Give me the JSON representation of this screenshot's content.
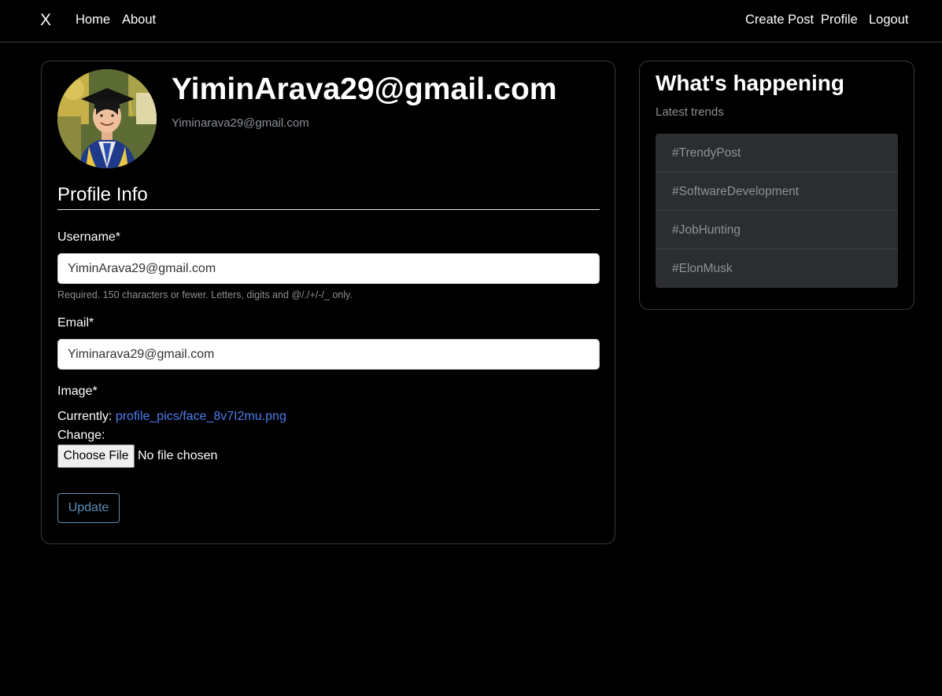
{
  "navbar": {
    "brand": "X",
    "left_links": [
      "Home",
      "About"
    ],
    "right_links": [
      "Create Post",
      "Profile",
      "Logout"
    ]
  },
  "profile": {
    "heading": "YiminArava29@gmail.com",
    "email": "Yiminarava29@gmail.com",
    "avatar_icon": "profile-photo"
  },
  "form": {
    "legend": "Profile Info",
    "username_label": "Username*",
    "username_value": "YiminArava29@gmail.com",
    "username_help": "Required. 150 characters or fewer. Letters, digits and @/./+/-/_ only.",
    "email_label": "Email*",
    "email_value": "Yiminarava29@gmail.com",
    "image_label": "Image*",
    "currently_label": "Currently:",
    "current_file": "profile_pics/face_8v7I2mu.png",
    "change_label": "Change:",
    "choose_file_label": "Choose File",
    "no_file_text": "No file chosen",
    "submit_label": "Update"
  },
  "sidebar": {
    "title": "What's happening",
    "subtitle": "Latest trends",
    "trends": [
      "#TrendyPost",
      "#SoftwareDevelopment",
      "#JobHunting",
      "#ElonMusk"
    ]
  },
  "colors": {
    "background": "#000000",
    "link": "#4d7cf0",
    "muted_text": "#8a8f96",
    "button_outline": "#5c8fb7",
    "trend_bg": "#2c2d30"
  }
}
